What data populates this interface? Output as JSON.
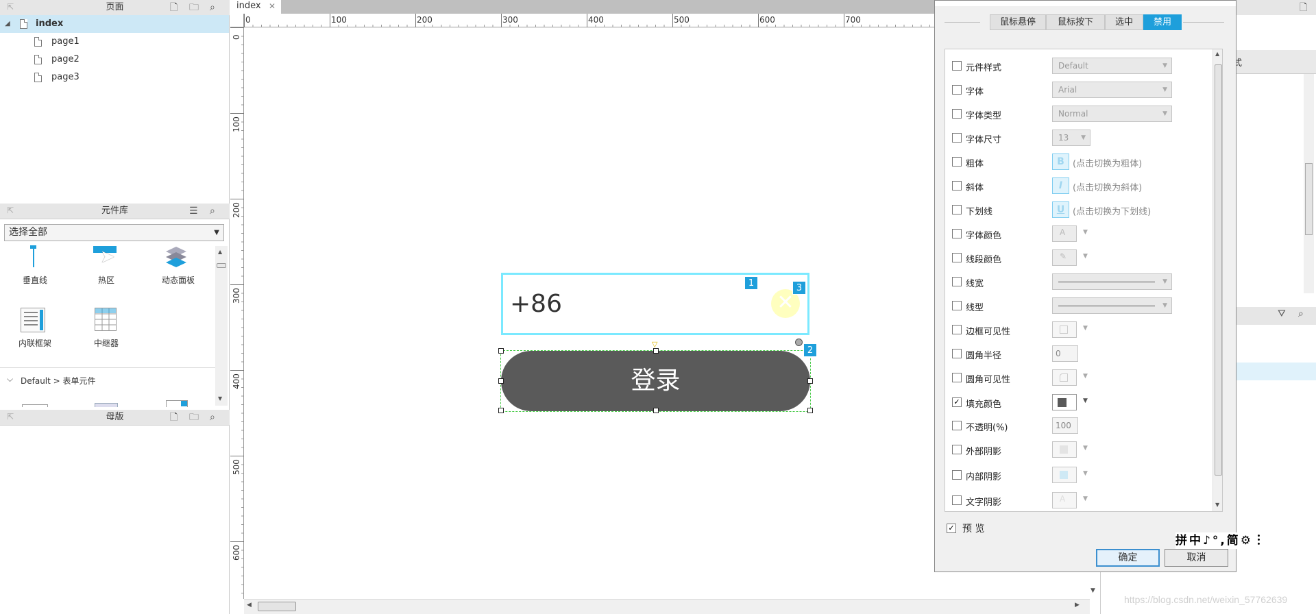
{
  "pages_panel": {
    "title": "页面",
    "tree": [
      {
        "label": "index",
        "selected": true
      },
      {
        "label": "page1"
      },
      {
        "label": "page2"
      },
      {
        "label": "page3"
      }
    ]
  },
  "library_panel": {
    "title": "元件库",
    "filter": "选择全部",
    "widgets_row1": [
      "垂直线",
      "热区",
      "动态面板"
    ],
    "widgets_row2": [
      "内联框架",
      "中继器"
    ],
    "section": "Default > 表单元件"
  },
  "masters_panel": {
    "title": "母版"
  },
  "canvas": {
    "tab": "index",
    "ruler_h": [
      "0",
      "100",
      "200",
      "300",
      "400",
      "500",
      "600",
      "700"
    ],
    "ruler_v": [
      "0",
      "100",
      "200",
      "300",
      "400",
      "500",
      "600"
    ],
    "phone_value": "+86",
    "login_label": "登录",
    "badges": [
      "1",
      "3",
      "2"
    ]
  },
  "right_strip": {
    "style_tab": "样式"
  },
  "dialog": {
    "tabs": [
      "鼠标悬停",
      "鼠标按下",
      "选中",
      "禁用"
    ],
    "active_tab": "禁用",
    "props": {
      "style": {
        "label": "元件样式",
        "value": "Default"
      },
      "font": {
        "label": "字体",
        "value": "Arial"
      },
      "font_type": {
        "label": "字体类型",
        "value": "Normal"
      },
      "font_size": {
        "label": "字体尺寸",
        "value": "13"
      },
      "bold": {
        "label": "粗体",
        "icon": "B",
        "hint": "(点击切换为粗体)"
      },
      "italic": {
        "label": "斜体",
        "icon": "I",
        "hint": "(点击切换为斜体)"
      },
      "underline": {
        "label": "下划线",
        "icon": "U",
        "hint": "(点击切换为下划线)"
      },
      "font_color": {
        "label": "字体颜色"
      },
      "line_color": {
        "label": "线段颜色"
      },
      "line_width": {
        "label": "线宽"
      },
      "line_type": {
        "label": "线型"
      },
      "border_vis": {
        "label": "边框可见性"
      },
      "radius": {
        "label": "圆角半径",
        "value": "0"
      },
      "radius_vis": {
        "label": "圆角可见性"
      },
      "fill": {
        "label": "填充颜色",
        "checked": "✓",
        "color": "#595959"
      },
      "opacity": {
        "label": "不透明(%)",
        "value": "100"
      },
      "outer_shadow": {
        "label": "外部阴影"
      },
      "inner_shadow": {
        "label": "内部阴影"
      },
      "text_shadow": {
        "label": "文字阴影"
      }
    },
    "preview_checked": "✓",
    "preview_label": "预 览",
    "ok": "确定",
    "cancel": "取消"
  },
  "ime_bar": "拼中♪°,简⚙︙",
  "watermark": "https://blog.csdn.net/weixin_57762639",
  "colors": {
    "accent": "#1e9fdb",
    "input_border": "#7be9ff",
    "button_fill": "#5a5a5a",
    "selection": "#cde8f6"
  }
}
